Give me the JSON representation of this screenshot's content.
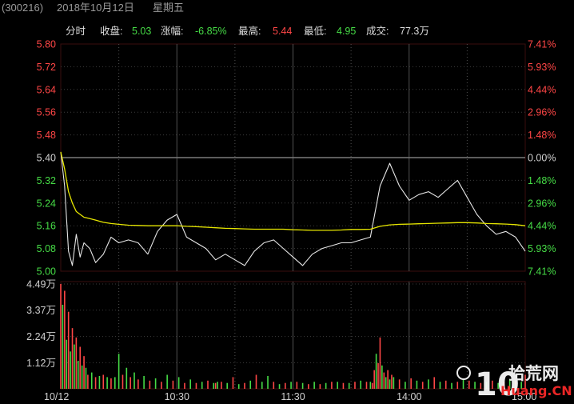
{
  "window": {
    "code": "(300216)",
    "date": "2018年10月12日",
    "weekday": "星期五"
  },
  "header": {
    "mode": "分时",
    "close_label": "收盘:",
    "close_value": "5.03",
    "change_label": "涨幅:",
    "change_value": "-6.85%",
    "high_label": "最高:",
    "high_value": "5.44",
    "low_label": "最低:",
    "low_value": "4.95",
    "volume_label": "成交:",
    "volume_value": "77.3万"
  },
  "watermark": {
    "number": "10",
    "cn": "拾荒网",
    "en": "Huang.CN"
  },
  "colors": {
    "background": "#000000",
    "price_line": "#e6e6e6",
    "avg_line": "#e6e600",
    "up": "#ff4646",
    "down": "#46dc46",
    "grid": "#3a0e0e",
    "prev_close_line": "#7a7a7a"
  },
  "chart_data": [
    {
      "type": "line",
      "name": "intraday-price",
      "x_labels": [
        "10/12",
        "10:30",
        "11:30",
        "14:00",
        "15:00"
      ],
      "y_left_ticks": [
        "5.80",
        "5.72",
        "5.64",
        "5.56",
        "5.48",
        "5.40",
        "5.32",
        "5.24",
        "5.16",
        "5.08",
        "5.00"
      ],
      "y_right_ticks": [
        "7.41%",
        "5.93%",
        "4.44%",
        "2.96%",
        "1.48%",
        "0.00%",
        "1.48%",
        "2.96%",
        "4.44%",
        "5.93%",
        "7.41%"
      ],
      "ylim": [
        5.0,
        5.8
      ],
      "prev_close": 5.4,
      "grid": true,
      "series": [
        {
          "x": [
            0,
            2,
            4,
            6,
            8,
            10,
            12,
            15,
            18,
            22,
            26,
            30,
            35,
            40,
            45,
            50,
            55,
            60,
            65,
            70,
            75,
            80,
            85,
            90,
            95,
            100,
            105,
            110,
            115,
            120,
            125,
            130,
            135,
            140,
            145,
            150,
            155,
            160,
            165,
            170,
            175,
            180,
            185,
            190,
            195,
            200,
            205,
            210,
            215,
            220,
            225,
            230,
            235,
            240
          ],
          "values": [
            5.42,
            5.3,
            5.07,
            5.02,
            5.13,
            5.05,
            5.1,
            5.08,
            5.03,
            5.06,
            5.12,
            5.1,
            5.11,
            5.1,
            5.06,
            5.14,
            5.18,
            5.2,
            5.12,
            5.1,
            5.08,
            5.04,
            5.06,
            5.04,
            5.02,
            5.07,
            5.1,
            5.11,
            5.08,
            5.05,
            5.02,
            5.06,
            5.08,
            5.09,
            5.1,
            5.1,
            5.11,
            5.12,
            5.3,
            5.38,
            5.3,
            5.25,
            5.27,
            5.28,
            5.26,
            5.29,
            5.32,
            5.26,
            5.2,
            5.16,
            5.13,
            5.14,
            5.12,
            5.07
          ]
        },
        {
          "x": [
            0,
            2,
            4,
            6,
            8,
            10,
            12,
            15,
            18,
            22,
            26,
            30,
            35,
            40,
            45,
            50,
            55,
            60,
            65,
            70,
            75,
            80,
            85,
            90,
            95,
            100,
            105,
            110,
            115,
            120,
            125,
            130,
            135,
            140,
            145,
            150,
            155,
            160,
            165,
            170,
            175,
            180,
            185,
            190,
            195,
            200,
            205,
            210,
            215,
            220,
            225,
            230,
            235,
            240
          ],
          "values": [
            5.42,
            5.36,
            5.28,
            5.24,
            5.21,
            5.2,
            5.19,
            5.185,
            5.18,
            5.172,
            5.168,
            5.165,
            5.162,
            5.161,
            5.16,
            5.16,
            5.16,
            5.16,
            5.158,
            5.157,
            5.155,
            5.153,
            5.151,
            5.15,
            5.149,
            5.148,
            5.148,
            5.148,
            5.148,
            5.146,
            5.145,
            5.144,
            5.144,
            5.144,
            5.145,
            5.147,
            5.147,
            5.148,
            5.158,
            5.163,
            5.165,
            5.166,
            5.167,
            5.168,
            5.169,
            5.17,
            5.171,
            5.171,
            5.17,
            5.168,
            5.167,
            5.166,
            5.164,
            5.16
          ]
        }
      ]
    },
    {
      "type": "bar",
      "name": "intraday-volume",
      "y_ticks": [
        "4.49万",
        "3.37万",
        "2.24万",
        "1.12万"
      ],
      "ylim": [
        0,
        4.49
      ],
      "x": [
        0,
        1,
        2,
        3,
        4,
        5,
        6,
        7,
        8,
        9,
        10,
        11,
        12,
        13,
        14,
        16,
        18,
        20,
        22,
        24,
        26,
        28,
        30,
        32,
        34,
        36,
        38,
        40,
        43,
        46,
        49,
        52,
        55,
        58,
        61,
        64,
        67,
        70,
        73,
        76,
        79,
        80,
        81,
        83,
        86,
        89,
        92,
        95,
        98,
        101,
        104,
        107,
        110,
        113,
        116,
        119,
        122,
        125,
        128,
        131,
        134,
        137,
        140,
        143,
        146,
        149,
        152,
        155,
        158,
        160,
        161,
        162,
        163,
        164,
        165,
        166,
        167,
        168,
        169,
        170,
        171,
        172,
        175,
        178,
        181,
        184,
        187,
        190,
        193,
        196,
        199,
        202,
        205,
        208,
        211,
        214,
        217,
        220,
        223,
        226,
        229,
        232,
        235,
        238,
        240
      ],
      "values": [
        4.49,
        3.6,
        4.2,
        2.1,
        3.3,
        1.6,
        2.6,
        1.9,
        2.2,
        1.2,
        1.8,
        1.0,
        1.4,
        0.9,
        0.6,
        0.7,
        0.5,
        0.55,
        0.6,
        0.5,
        0.45,
        0.5,
        1.5,
        0.6,
        0.9,
        0.5,
        0.7,
        0.4,
        0.55,
        0.35,
        0.45,
        0.3,
        0.6,
        0.35,
        0.5,
        0.25,
        0.4,
        0.25,
        0.3,
        0.35,
        0.25,
        0.25,
        0.3,
        0.3,
        0.25,
        0.5,
        0.2,
        0.25,
        0.35,
        0.6,
        0.3,
        0.55,
        0.3,
        0.2,
        0.25,
        0.3,
        0.3,
        0.25,
        0.2,
        0.3,
        0.2,
        0.25,
        0.3,
        0.3,
        0.25,
        0.25,
        0.3,
        0.35,
        0.3,
        0.3,
        0.25,
        0.8,
        1.5,
        1.1,
        2.2,
        1.0,
        0.7,
        0.5,
        0.8,
        0.4,
        0.6,
        0.5,
        0.4,
        0.3,
        0.45,
        0.35,
        0.3,
        0.4,
        0.5,
        0.3,
        0.35,
        0.25,
        0.3,
        0.4,
        0.35,
        0.3,
        0.25,
        0.3,
        0.35,
        0.25,
        0.3,
        0.4,
        0.35,
        0.3,
        0.6
      ],
      "direction": [
        "up",
        "down",
        "up",
        "down",
        "up",
        "down",
        "up",
        "down",
        "up",
        "down",
        "up",
        "down",
        "up",
        "down",
        "up",
        "down",
        "up",
        "down",
        "up",
        "down",
        "up",
        "down",
        "down",
        "up",
        "down",
        "up",
        "down",
        "up",
        "down",
        "up",
        "down",
        "up",
        "down",
        "up",
        "down",
        "up",
        "down",
        "up",
        "down",
        "up",
        "down",
        "up",
        "down",
        "up",
        "down",
        "up",
        "down",
        "up",
        "down",
        "up",
        "down",
        "down",
        "up",
        "down",
        "up",
        "down",
        "up",
        "down",
        "up",
        "down",
        "up",
        "down",
        "up",
        "down",
        "up",
        "down",
        "up",
        "down",
        "up",
        "down",
        "up",
        "up",
        "down",
        "up",
        "up",
        "down",
        "up",
        "down",
        "up",
        "down",
        "up",
        "down",
        "up",
        "down",
        "up",
        "down",
        "up",
        "down",
        "up",
        "down",
        "up",
        "down",
        "up",
        "down",
        "up",
        "down",
        "up",
        "down",
        "up",
        "down",
        "up",
        "down",
        "up",
        "down",
        "up"
      ]
    }
  ]
}
